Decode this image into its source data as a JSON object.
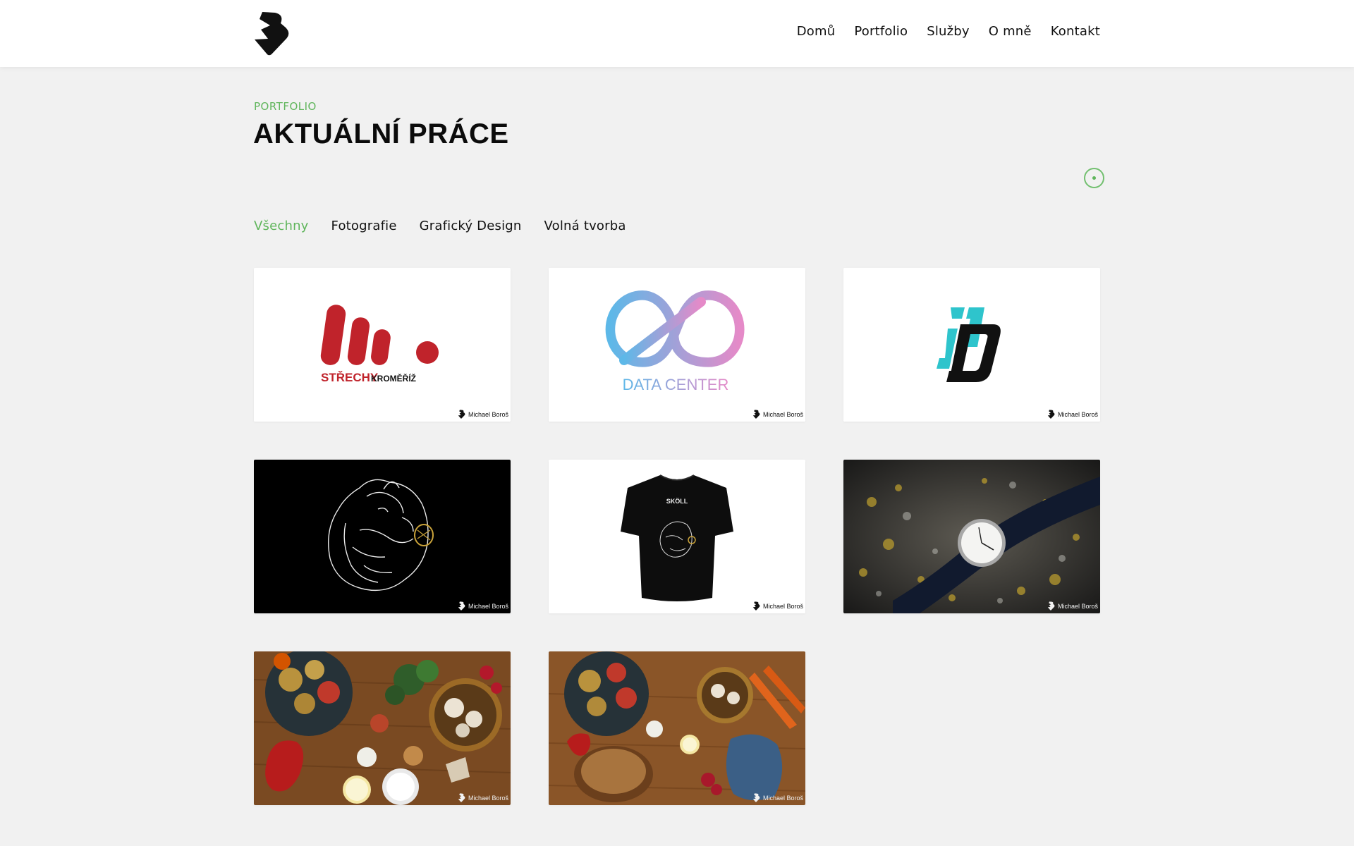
{
  "nav": {
    "items": [
      "Domů",
      "Portfolio",
      "Služby",
      "O mně",
      "Kontakt"
    ]
  },
  "section": {
    "eyebrow": "PORTFOLIO",
    "title": "AKTUÁLNÍ PRÁCE"
  },
  "filters": {
    "items": [
      "Všechny",
      "Fotografie",
      "Grafický Design",
      "Volná tvorba"
    ],
    "active": "Všechny"
  },
  "cards": [
    {
      "name": "strechy-kromeriz-logo",
      "theme": "light",
      "logo_text_main": "STŘECHY",
      "logo_text_sub": "KROMĚŘÍŽ",
      "watermark": "Michael Boroš"
    },
    {
      "name": "data-center-logo",
      "theme": "light",
      "logo_text_main": "DATA CENTER",
      "watermark": "Michael Boroš"
    },
    {
      "name": "id-monogram-logo",
      "theme": "light",
      "watermark": "Michael Boroš"
    },
    {
      "name": "bear-illustration",
      "theme": "dark",
      "watermark": "Michael Boroš"
    },
    {
      "name": "bear-tshirt-mockup",
      "theme": "light",
      "shirt_text": "SKÖLL",
      "watermark": "Michael Boroš"
    },
    {
      "name": "wristwatch-photo",
      "theme": "dark",
      "watermark": "Michael Boroš"
    },
    {
      "name": "vegetables-photo-1",
      "theme": "dark",
      "watermark": "Michael Boroš"
    },
    {
      "name": "vegetables-photo-2",
      "theme": "dark",
      "watermark": "Michael Boroš"
    }
  ],
  "colors": {
    "accent": "#5fb55b",
    "background": "#f1f1f1",
    "header": "#ffffff",
    "strechy_red": "#c0232b",
    "data_center_blue": "#5db8e8",
    "data_center_pink": "#e58ac8",
    "monogram_teal": "#2ec4cc"
  }
}
